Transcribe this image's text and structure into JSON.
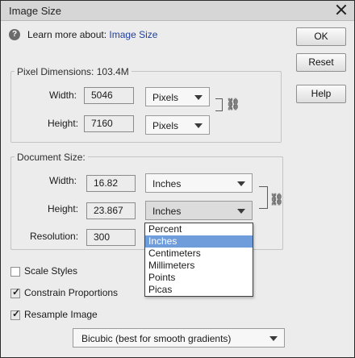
{
  "window": {
    "title": "Image Size"
  },
  "help": {
    "prefix": "Learn more about:",
    "link": "Image Size"
  },
  "buttons": {
    "ok": "OK",
    "reset": "Reset",
    "help": "Help"
  },
  "pixel_dimensions": {
    "label": "Pixel Dimensions:",
    "size": "103.4M",
    "width_label": "Width:",
    "width_value": "5046",
    "width_unit": "Pixels",
    "height_label": "Height:",
    "height_value": "7160",
    "height_unit": "Pixels"
  },
  "document_size": {
    "label": "Document Size:",
    "width_label": "Width:",
    "width_value": "16.82",
    "width_unit": "Inches",
    "height_label": "Height:",
    "height_value": "23.867",
    "height_unit": "Inches",
    "resolution_label": "Resolution:",
    "resolution_value": "300"
  },
  "unit_menu": {
    "items": [
      "Percent",
      "Inches",
      "Centimeters",
      "Millimeters",
      "Points",
      "Picas"
    ],
    "selected": "Inches"
  },
  "checkboxes": {
    "scale_styles": {
      "label": "Scale Styles",
      "checked": false
    },
    "constrain": {
      "label": "Constrain Proportions",
      "checked": true
    },
    "resample": {
      "label": "Resample Image",
      "checked": true
    }
  },
  "resample_method": "Bicubic (best for smooth gradients)"
}
